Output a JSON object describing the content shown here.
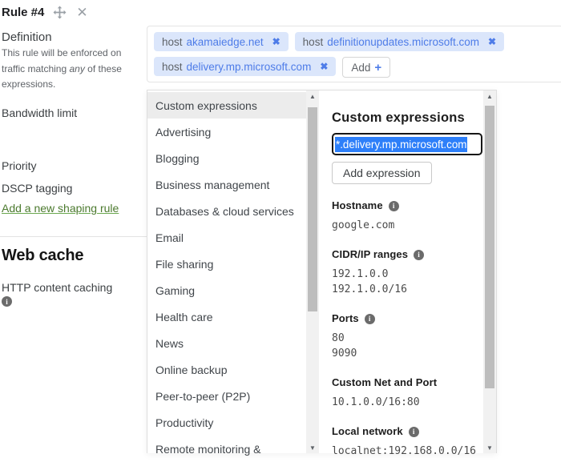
{
  "rule_header": {
    "title": "Rule #4"
  },
  "left_panel": {
    "definition_label": "Definition",
    "definition_desc_line1": "This rule will be enforced on",
    "definition_desc_line2_pre": "traffic matching ",
    "definition_desc_any": "any",
    "definition_desc_line2_post": " of these",
    "definition_desc_line3": "expressions.",
    "bandwidth_limit_label": "Bandwidth limit",
    "priority_label": "Priority",
    "dscp_label": "DSCP tagging",
    "add_rule_link": "Add a new shaping rule",
    "web_cache_heading": "Web cache",
    "http_caching_label": "HTTP content caching"
  },
  "expression_chips": {
    "chips": [
      {
        "prefix": "host",
        "value": "akamaiedge.net"
      },
      {
        "prefix": "host",
        "value": "definitionupdates.microsoft.com"
      },
      {
        "prefix": "host",
        "value": "delivery.mp.microsoft.com"
      }
    ],
    "close_glyph": "✖",
    "add_button_label": "Add",
    "add_button_plus": "+"
  },
  "category_list": {
    "selected": "Custom expressions",
    "items": [
      "Custom expressions",
      "Advertising",
      "Blogging",
      "Business management",
      "Databases & cloud services",
      "Email",
      "File sharing",
      "Gaming",
      "Health care",
      "News",
      "Online backup",
      "Peer-to-peer (P2P)",
      "Productivity",
      "Remote monitoring &"
    ]
  },
  "custom_expressions_panel": {
    "heading": "Custom expressions",
    "input_value": "*.delivery.mp.microsoft.com",
    "add_expression_button": "Add expression",
    "sections": [
      {
        "title": "Hostname",
        "has_info": true,
        "values": [
          "google.com"
        ]
      },
      {
        "title": "CIDR/IP ranges",
        "has_info": true,
        "values": [
          "192.1.0.0",
          "192.1.0.0/16"
        ]
      },
      {
        "title": "Ports",
        "has_info": true,
        "values": [
          "80",
          "9090"
        ]
      },
      {
        "title": "Custom Net and Port",
        "has_info": false,
        "values": [
          "10.1.0.0/16:80"
        ]
      },
      {
        "title": "Local network",
        "has_info": true,
        "values": [
          "localnet:192.168.0.0/16"
        ]
      }
    ]
  },
  "colors": {
    "chip_background": "#dbe6fb",
    "chip_accent_blue": "#4e7ce8",
    "selection_blue": "#2d7ff9",
    "link_green": "#4c7a2f",
    "selected_row_gray": "#ececec",
    "scrollbar_track": "#f1f1f1",
    "scrollbar_thumb": "#bdbdbd"
  }
}
